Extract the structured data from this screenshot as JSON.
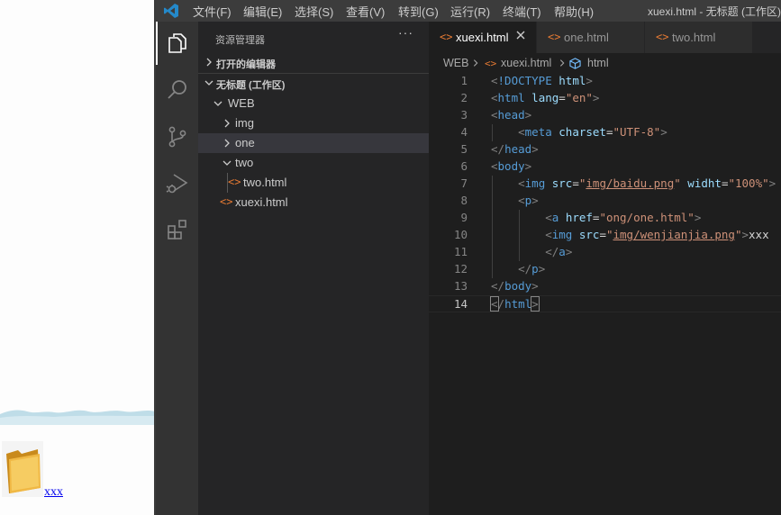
{
  "browser": {
    "link_text": "xxx"
  },
  "vscode": {
    "menu": [
      "文件(F)",
      "编辑(E)",
      "选择(S)",
      "查看(V)",
      "转到(G)",
      "运行(R)",
      "终端(T)",
      "帮助(H)"
    ],
    "window_title": "xuexi.html - 无标题 (工作区)",
    "activity_bar": [
      "files-icon",
      "search-icon",
      "source-control-icon",
      "run-debug-icon",
      "extensions-icon"
    ],
    "sidebar": {
      "title": "资源管理器",
      "more": "···",
      "open_editors": "打开的编辑器",
      "workspace": "无标题 (工作区)",
      "tree": {
        "root": "WEB",
        "img": "img",
        "one": "one",
        "two": "two",
        "two_html": "two.html",
        "xuexi_html": "xuexi.html"
      }
    },
    "tabs": [
      {
        "name": "xuexi.html",
        "active": true
      },
      {
        "name": "one.html",
        "active": false
      },
      {
        "name": "two.html",
        "active": false
      }
    ],
    "file_icon": "<>",
    "breadcrumbs": [
      "WEB",
      "xuexi.html",
      "html"
    ],
    "code": [
      [
        [
          "t-bracket",
          "<"
        ],
        [
          "t-tag",
          "!DOCTYPE "
        ],
        [
          "t-attr",
          "html"
        ],
        [
          "t-bracket",
          ">"
        ]
      ],
      [
        [
          "t-bracket",
          "<"
        ],
        [
          "t-tag",
          "html "
        ],
        [
          "t-attr",
          "lang"
        ],
        [
          "t-text",
          "="
        ],
        [
          "t-str",
          "\"en\""
        ],
        [
          "t-bracket",
          ">"
        ]
      ],
      [
        [
          "t-bracket",
          "<"
        ],
        [
          "t-tag",
          "head"
        ],
        [
          "t-bracket",
          ">"
        ]
      ],
      [
        [
          "t-text",
          "    "
        ],
        [
          "t-bracket",
          "<"
        ],
        [
          "t-tag",
          "meta "
        ],
        [
          "t-attr",
          "charset"
        ],
        [
          "t-text",
          "="
        ],
        [
          "t-str",
          "\"UTF-8\""
        ],
        [
          "t-bracket",
          ">"
        ]
      ],
      [
        [
          "t-bracket",
          "</"
        ],
        [
          "t-tag",
          "head"
        ],
        [
          "t-bracket",
          ">"
        ]
      ],
      [
        [
          "t-bracket",
          "<"
        ],
        [
          "t-tag",
          "body"
        ],
        [
          "t-bracket",
          ">"
        ]
      ],
      [
        [
          "t-text",
          "    "
        ],
        [
          "t-bracket",
          "<"
        ],
        [
          "t-tag",
          "img "
        ],
        [
          "t-attr",
          "src"
        ],
        [
          "t-text",
          "="
        ],
        [
          "t-str",
          "\""
        ],
        [
          "t-link",
          "img/baidu.png"
        ],
        [
          "t-str",
          "\""
        ],
        [
          "t-text",
          " "
        ],
        [
          "t-attr",
          "widht"
        ],
        [
          "t-text",
          "="
        ],
        [
          "t-str",
          "\"100%\""
        ],
        [
          "t-bracket",
          ">"
        ]
      ],
      [
        [
          "t-text",
          "    "
        ],
        [
          "t-bracket",
          "<"
        ],
        [
          "t-tag",
          "p"
        ],
        [
          "t-bracket",
          ">"
        ]
      ],
      [
        [
          "t-text",
          "        "
        ],
        [
          "t-bracket",
          "<"
        ],
        [
          "t-tag",
          "a "
        ],
        [
          "t-attr",
          "href"
        ],
        [
          "t-text",
          "="
        ],
        [
          "t-str",
          "\"ong/one.html\""
        ],
        [
          "t-bracket",
          ">"
        ]
      ],
      [
        [
          "t-text",
          "        "
        ],
        [
          "t-bracket",
          "<"
        ],
        [
          "t-tag",
          "img "
        ],
        [
          "t-attr",
          "src"
        ],
        [
          "t-text",
          "="
        ],
        [
          "t-str",
          "\""
        ],
        [
          "t-link",
          "img/wenjianjia.png"
        ],
        [
          "t-str",
          "\""
        ],
        [
          "t-bracket",
          ">"
        ],
        [
          "t-text",
          "xxx"
        ]
      ],
      [
        [
          "t-text",
          "        "
        ],
        [
          "t-bracket",
          "</"
        ],
        [
          "t-tag",
          "a"
        ],
        [
          "t-bracket",
          ">"
        ]
      ],
      [
        [
          "t-text",
          "    "
        ],
        [
          "t-bracket",
          "</"
        ],
        [
          "t-tag",
          "p"
        ],
        [
          "t-bracket",
          ">"
        ]
      ],
      [
        [
          "t-bracket",
          "</"
        ],
        [
          "t-tag",
          "body"
        ],
        [
          "t-bracket",
          ">"
        ]
      ],
      [
        [
          "t-bracket bm",
          "<"
        ],
        [
          "t-bracket",
          "/"
        ],
        [
          "t-tag",
          "html"
        ],
        [
          "t-bracket bm",
          ">"
        ]
      ]
    ],
    "line_numbers": [
      "1",
      "2",
      "3",
      "4",
      "5",
      "6",
      "7",
      "8",
      "9",
      "10",
      "11",
      "12",
      "13",
      "14"
    ],
    "active_line": 14,
    "colors": {
      "titlebar": "#3c3c3c",
      "activitybar": "#333333",
      "sidebar": "#252526",
      "editor": "#1e1e1e",
      "tag": "#569cd6",
      "attr": "#9cdcfe",
      "string": "#ce9178",
      "html_file_icon": "#e37933"
    }
  }
}
